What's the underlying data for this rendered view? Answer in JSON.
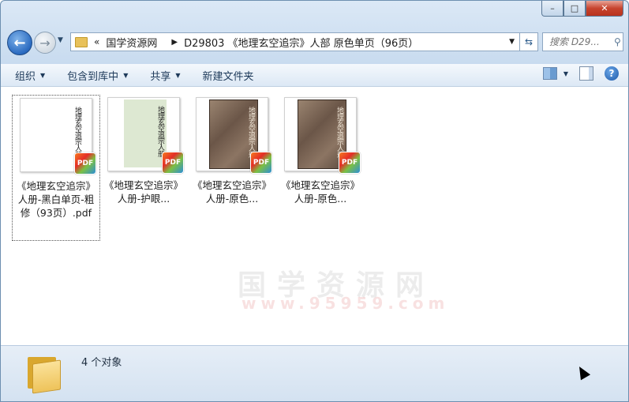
{
  "window": {
    "caption": {
      "minimize": "–",
      "maximize": "□",
      "close": "✕"
    }
  },
  "nav": {
    "back_icon": "back-arrow-icon",
    "forward_icon": "forward-arrow-icon",
    "breadcrumb_chevron": "«",
    "breadcrumb": [
      "国学资源网",
      "D29803 《地理玄空追宗》人部 原色单页（96页）"
    ],
    "search_placeholder": "搜索 D29..."
  },
  "toolbar": {
    "organize": "组织",
    "include_library": "包含到库中",
    "share": "共享",
    "new_folder": "新建文件夹"
  },
  "files": [
    {
      "label": "《地理玄空追宗》人册-黑白单页-粗修（93页）.pdf",
      "style": "bw",
      "selected": true
    },
    {
      "label": "《地理玄空追宗》人册-护眼...",
      "style": "green",
      "selected": false
    },
    {
      "label": "《地理玄空追宗》人册-原色...",
      "style": "orig",
      "selected": false
    },
    {
      "label": "《地理玄空追宗》人册-原色...",
      "style": "orig",
      "selected": false
    }
  ],
  "thumb_text": "地理玄空追宗人册",
  "pdf_badge": "PDF",
  "watermark": {
    "top": "国学资源网",
    "bottom": "www.95959.com"
  },
  "status": {
    "count": "4 个对象"
  }
}
